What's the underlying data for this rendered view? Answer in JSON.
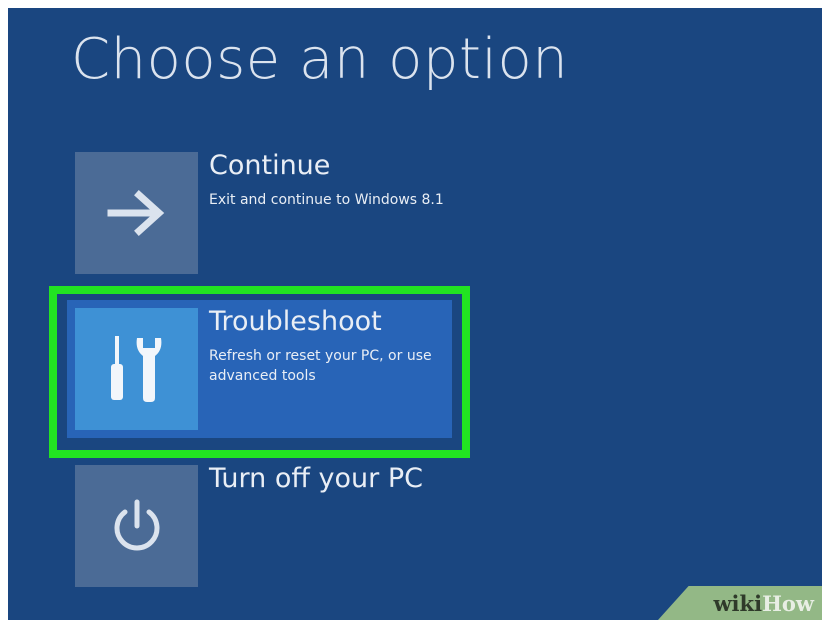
{
  "title": "Choose an option",
  "options": [
    {
      "label": "Continue",
      "description": "Exit and continue to Windows 8.1",
      "icon": "arrow-right-icon"
    },
    {
      "label": "Troubleshoot",
      "description": "Refresh or reset your PC, or use advanced tools",
      "icon": "tools-icon",
      "selected": true
    },
    {
      "label": "Turn off your PC",
      "description": "",
      "icon": "power-icon"
    }
  ],
  "watermark": {
    "part1": "wiki",
    "part2": "How"
  },
  "colors": {
    "background": "#1a4680",
    "tile": "#4b6b96",
    "selected_tile": "#3e91d5",
    "selected_bg": "#2864b7",
    "highlight_border": "#22e322"
  }
}
